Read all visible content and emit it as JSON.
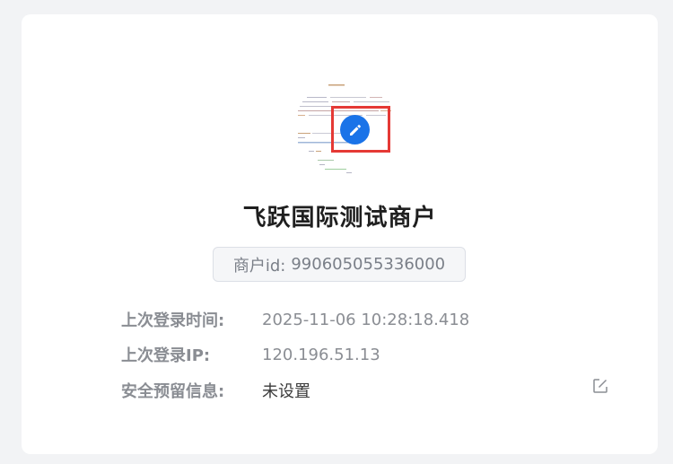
{
  "merchant": {
    "name": "飞跃国际测试商户",
    "id_label": "商户id:",
    "id_value": "990605055336000"
  },
  "info": {
    "last_login_time_label": "上次登录时间:",
    "last_login_time_value": "2025-11-06 10:28:18.418",
    "last_login_ip_label": "上次登录IP:",
    "last_login_ip_value": "120.196.51.13",
    "security_label": "安全预留信息:",
    "security_value": "未设置"
  },
  "icons": {
    "avatar_edit": "pencil-icon",
    "security_edit": "edit-square-icon"
  },
  "colors": {
    "accent": "#1a73e8",
    "highlight": "#e53935"
  }
}
